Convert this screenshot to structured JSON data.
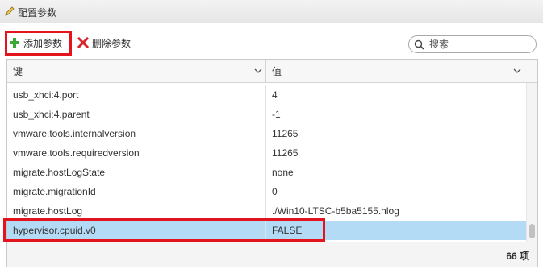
{
  "panel": {
    "title": "配置参数"
  },
  "toolbar": {
    "add_label": "添加参数",
    "delete_label": "删除参数"
  },
  "search": {
    "placeholder": "搜索",
    "value": ""
  },
  "table": {
    "columns": [
      {
        "label": "键"
      },
      {
        "label": "值"
      }
    ],
    "rows": [
      {
        "key": "usb_xhci:4.port",
        "value": "4"
      },
      {
        "key": "usb_xhci:4.parent",
        "value": "-1"
      },
      {
        "key": "vmware.tools.internalversion",
        "value": "11265"
      },
      {
        "key": "vmware.tools.requiredversion",
        "value": "11265"
      },
      {
        "key": "migrate.hostLogState",
        "value": "none"
      },
      {
        "key": "migrate.migrationId",
        "value": "0"
      },
      {
        "key": "migrate.hostLog",
        "value": "./Win10-LTSC-b5ba5155.hlog"
      },
      {
        "key": "hypervisor.cpuid.v0",
        "value": "FALSE"
      }
    ],
    "selected_row": "hypervisor.cpuid.v0"
  },
  "footer": {
    "count": "66 项"
  },
  "colors": {
    "selection": "#b3dbf6",
    "highlight_box": "#e3141e",
    "add_icon": "#3aa935",
    "delete_icon": "#d9262c"
  },
  "icons": {
    "title": "pencil-icon",
    "add": "plus-icon",
    "delete": "x-icon",
    "search": "magnifier-icon",
    "sort": "chevron-down-icon"
  }
}
